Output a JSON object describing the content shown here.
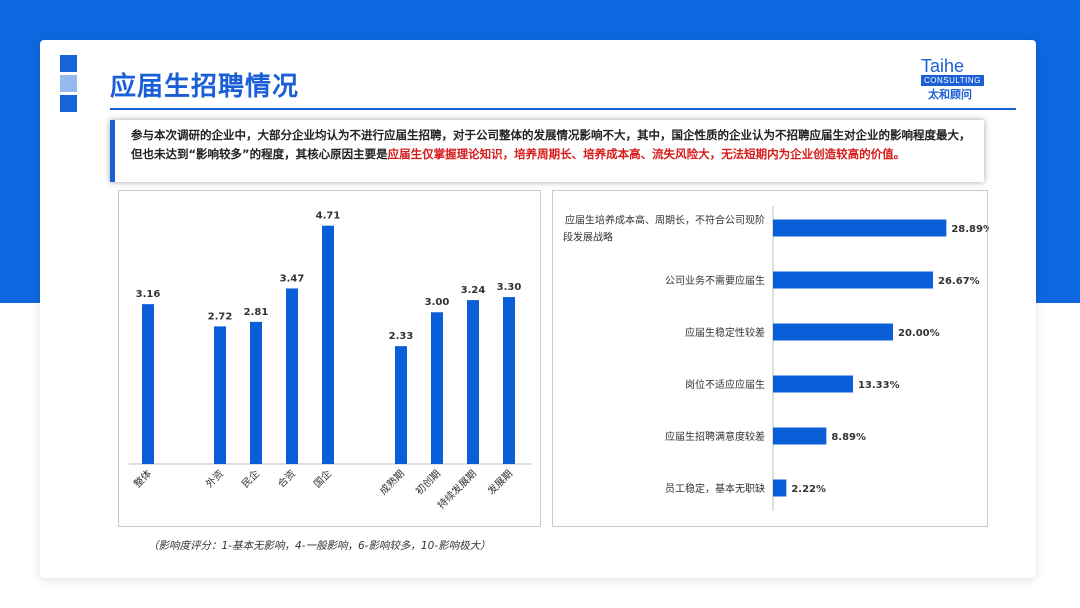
{
  "title": "应届生招聘情况",
  "logo": {
    "brand": "Taihe",
    "sub": "CONSULTING",
    "cn": "太和顾问"
  },
  "summary": {
    "text_before": "参与本次调研的企业中，大部分企业均认为不进行应届生招聘，对于公司整体的发展情况影响不大，其中，国企性质的企业认为不招聘应届生对企业的影响程度最大，但也未达到“影响较多”的程度，其核心原因主要是",
    "text_highlight": "应届生仅掌握理论知识，培养周期长、培养成本高、流失风险大，无法短期内为企业创造较高的价值。"
  },
  "footnote": "（影响度评分：1-基本无影响，4-一般影响，6-影响较多，10-影响极大）",
  "colors": {
    "bar": "#0a5fd8",
    "highlight": "#d81b1b",
    "accent": "#1a5fd6"
  },
  "chart_data": [
    {
      "type": "bar",
      "categories": [
        "整体",
        "外资",
        "民企",
        "合资",
        "国企",
        "成熟期",
        "初创期",
        "持续发展期",
        "发展期"
      ],
      "values": [
        3.16,
        2.72,
        2.81,
        3.47,
        4.71,
        2.33,
        3.0,
        3.24,
        3.3
      ],
      "value_labels": [
        "3.16",
        "2.72",
        "2.81",
        "3.47",
        "4.71",
        "2.33",
        "3.00",
        "3.24",
        "3.30"
      ],
      "ylim": [
        0,
        5.1
      ],
      "grid": false,
      "legend": "none"
    },
    {
      "type": "bar",
      "orientation": "horizontal",
      "categories": [
        "应届生培养成本高、周期长，不符合公司现阶段发展战略",
        "公司业务不需要应届生",
        "应届生稳定性较差",
        "岗位不适应应届生",
        "应届生招聘满意度较差",
        "员工稳定，基本无职缺"
      ],
      "category_lines": [
        [
          "应届生培养成本高、周期长，不符合公司现阶",
          "段发展战略"
        ],
        [
          "公司业务不需要应届生"
        ],
        [
          "应届生稳定性较差"
        ],
        [
          "岗位不适应应届生"
        ],
        [
          "应届生招聘满意度较差"
        ],
        [
          "员工稳定，基本无职缺"
        ]
      ],
      "values": [
        28.89,
        26.67,
        20.0,
        13.33,
        8.89,
        2.22
      ],
      "value_labels": [
        "28.89%",
        "26.67%",
        "20.00%",
        "13.33%",
        "8.89%",
        "2.22%"
      ],
      "xlim": [
        0,
        35
      ],
      "grid": false,
      "legend": "none"
    }
  ]
}
